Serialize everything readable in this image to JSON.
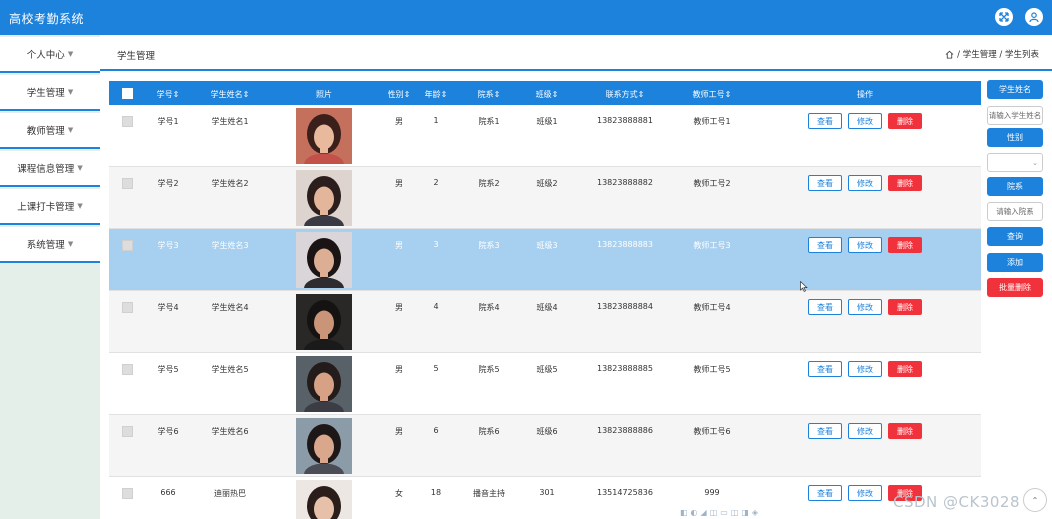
{
  "app": {
    "title": "高校考勤系统"
  },
  "sidebar": {
    "items": [
      {
        "label": "个人中心"
      },
      {
        "label": "学生管理"
      },
      {
        "label": "教师管理"
      },
      {
        "label": "课程信息管理"
      },
      {
        "label": "上课打卡管理"
      },
      {
        "label": "系统管理"
      }
    ]
  },
  "header": {
    "title": "学生管理",
    "breadcrumb": "/ 学生管理 / 学生列表"
  },
  "table": {
    "columns": [
      "学号",
      "学生姓名",
      "照片",
      "性别",
      "年龄",
      "院系",
      "班级",
      "联系方式",
      "教师工号",
      "操作"
    ],
    "sort_mark": "⇕",
    "rows": [
      {
        "id": "学号1",
        "name": "学生姓名1",
        "gender": "男",
        "age": "1",
        "dept": "院系1",
        "class": "班级1",
        "phone": "13823888881",
        "teacher": "教师工号1"
      },
      {
        "id": "学号2",
        "name": "学生姓名2",
        "gender": "男",
        "age": "2",
        "dept": "院系2",
        "class": "班级2",
        "phone": "13823888882",
        "teacher": "教师工号2"
      },
      {
        "id": "学号3",
        "name": "学生姓名3",
        "gender": "男",
        "age": "3",
        "dept": "院系3",
        "class": "班级3",
        "phone": "13823888883",
        "teacher": "教师工号3"
      },
      {
        "id": "学号4",
        "name": "学生姓名4",
        "gender": "男",
        "age": "4",
        "dept": "院系4",
        "class": "班级4",
        "phone": "13823888884",
        "teacher": "教师工号4"
      },
      {
        "id": "学号5",
        "name": "学生姓名5",
        "gender": "男",
        "age": "5",
        "dept": "院系5",
        "class": "班级5",
        "phone": "13823888885",
        "teacher": "教师工号5"
      },
      {
        "id": "学号6",
        "name": "学生姓名6",
        "gender": "男",
        "age": "6",
        "dept": "院系6",
        "class": "班级6",
        "phone": "13823888886",
        "teacher": "教师工号6"
      },
      {
        "id": "666",
        "name": "迪丽热巴",
        "gender": "女",
        "age": "18",
        "dept": "播音主持",
        "class": "301",
        "phone": "13514725836",
        "teacher": "999"
      }
    ],
    "selected_row": 3,
    "actions": {
      "view": "查看",
      "edit": "修改",
      "delete": "删除"
    }
  },
  "right_panel": {
    "name_label": "学生姓名",
    "name_placeholder": "请输入学生姓名",
    "gender_label": "性别",
    "dept_label": "院系",
    "dept_placeholder": "请输入院系",
    "query": "查询",
    "add": "添加",
    "batch_delete": "批量删除"
  },
  "watermark": "CSDN @CK3028",
  "colors": {
    "primary": "#1d82dc",
    "danger": "#f0323c",
    "selected": "#a7cfef",
    "sidebar_bg": "#e5efe9"
  }
}
